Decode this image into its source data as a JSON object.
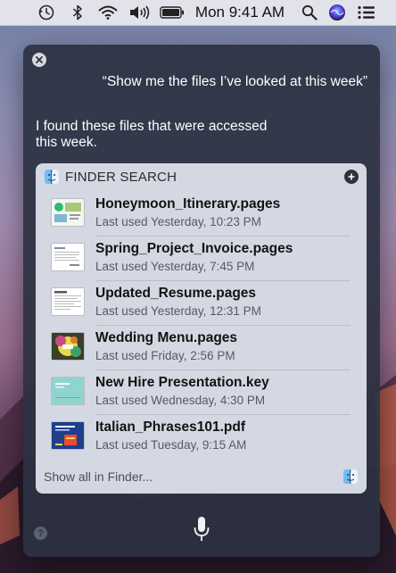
{
  "menubar": {
    "clock": "Mon 9:41 AM",
    "icons": [
      "time-machine-icon",
      "bluetooth-icon",
      "wifi-icon",
      "volume-icon",
      "battery-icon",
      "spotlight-search-icon",
      "siri-icon",
      "notification-center-icon"
    ]
  },
  "siri": {
    "query": "“Show me the files I’ve looked at this week”",
    "response": "I found these files that were accessed this week.",
    "card": {
      "title": "FINDER SEARCH",
      "files": [
        {
          "name": "Honeymoon_Itinerary.pages",
          "last_used": "Last used Yesterday, 10:23 PM"
        },
        {
          "name": "Spring_Project_Invoice.pages",
          "last_used": "Last used Yesterday, 7:45 PM"
        },
        {
          "name": "Updated_Resume.pages",
          "last_used": "Last used Yesterday, 12:31 PM"
        },
        {
          "name": "Wedding Menu.pages",
          "last_used": "Last used Friday, 2:56 PM"
        },
        {
          "name": "New Hire Presentation.key",
          "last_used": "Last used Wednesday, 4:30 PM"
        },
        {
          "name": "Italian_Phrases101.pdf",
          "last_used": "Last used Tuesday, 9:15 AM"
        }
      ],
      "show_all": "Show all in Finder..."
    },
    "help": "?"
  },
  "colors": {
    "panel": "#2c3242",
    "card": "#dee2ec",
    "accent": "#2f3136"
  }
}
